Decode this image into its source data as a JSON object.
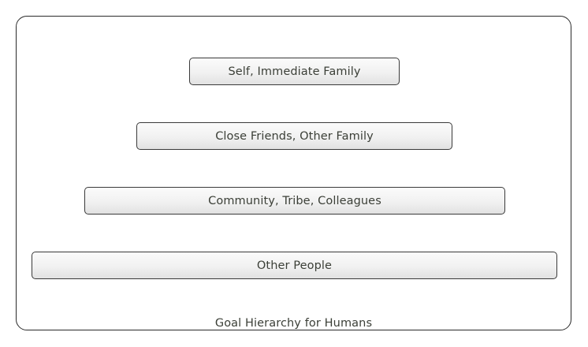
{
  "diagram": {
    "tiers": [
      {
        "label": "Self, Immediate Family"
      },
      {
        "label": "Close Friends, Other Family"
      },
      {
        "label": "Community, Tribe, Colleagues"
      },
      {
        "label": "Other People"
      }
    ],
    "caption": "Goal Hierarchy for Humans"
  },
  "colors": {
    "border": "#2a2a2a",
    "text": "#3b3f37",
    "box_fill_top": "#fbfbfb",
    "box_fill_bottom": "#e2e2e2"
  }
}
